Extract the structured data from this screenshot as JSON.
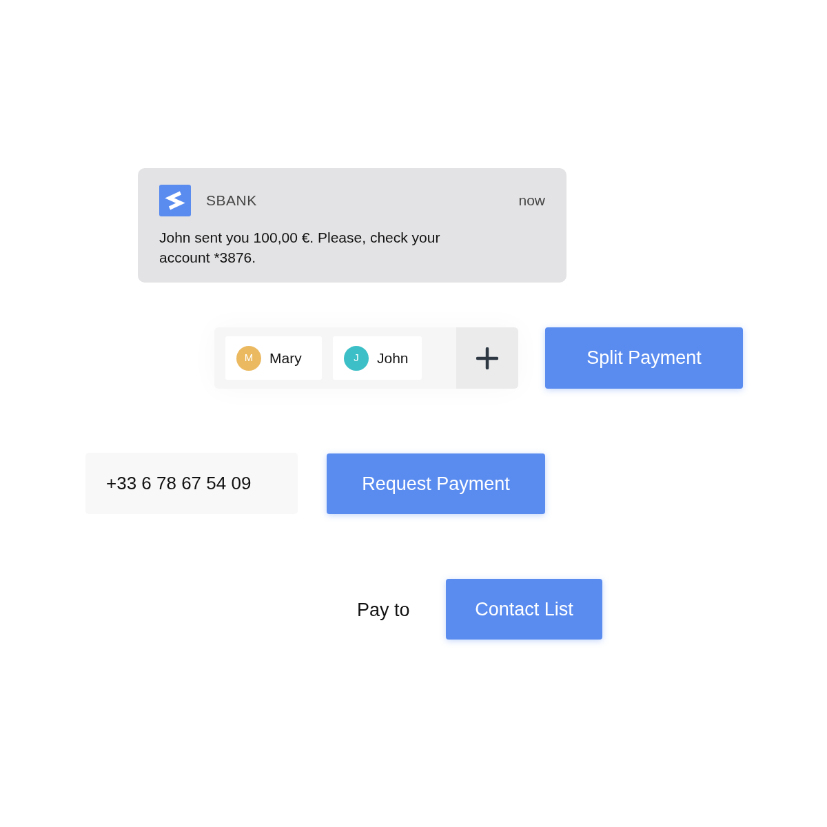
{
  "notification": {
    "app_name": "SBANK",
    "time": "now",
    "message": "John sent you 100,00 €. Please, check your account *3876."
  },
  "split": {
    "participants": [
      {
        "initial": "M",
        "name": "Mary",
        "color": "#ebb960"
      },
      {
        "initial": "J",
        "name": "John",
        "color": "#3cbfc6"
      }
    ],
    "button": "Split Payment"
  },
  "request": {
    "phone": "+33 6 78 67 54 09",
    "button": "Request Payment"
  },
  "pay": {
    "label": "Pay to",
    "button": "Contact List"
  }
}
